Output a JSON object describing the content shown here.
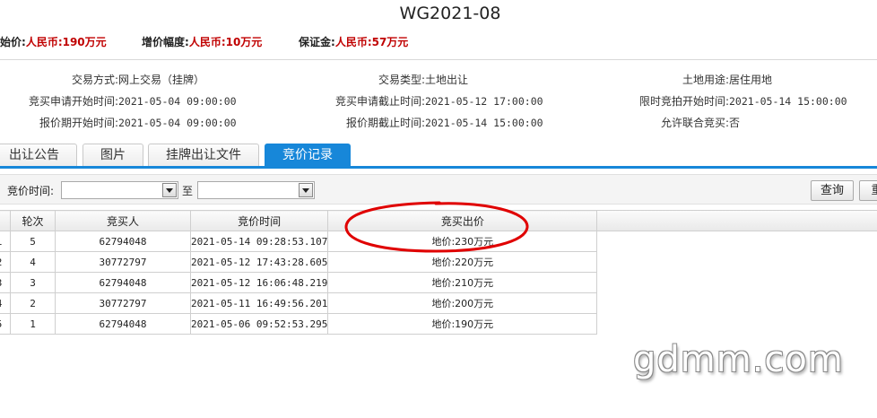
{
  "title": "WG2021-08",
  "price_bar": {
    "start_label": "起始价:",
    "start_value": "人民币:190万元",
    "increment_label": "增价幅度:",
    "increment_value": "人民币:10万元",
    "deposit_label": "保证金:",
    "deposit_value": "人民币:57万元"
  },
  "info": {
    "trade_mode_label": "交易方式:",
    "trade_mode_value": "网上交易（挂牌）",
    "trade_type_label": "交易类型:",
    "trade_type_value": "土地出让",
    "land_use_label": "土地用途:",
    "land_use_value": "居住用地",
    "apply_start_label": "竞买申请开始时间:",
    "apply_start_value": "2021-05-04 09:00:00",
    "apply_end_label": "竞买申请截止时间:",
    "apply_end_value": "2021-05-12 17:00:00",
    "timed_start_label": "限时竞拍开始时间:",
    "timed_start_value": "2021-05-14 15:00:00",
    "quote_start_label": "报价期开始时间:",
    "quote_start_value": "2021-05-04 09:00:00",
    "quote_end_label": "报价期截止时间:",
    "quote_end_value": "2021-05-14 15:00:00",
    "joint_label": "允许联合竞买:",
    "joint_value": "否"
  },
  "tabs": [
    {
      "label": "出让公告"
    },
    {
      "label": "图片"
    },
    {
      "label": "挂牌出让文件"
    },
    {
      "label": "竞价记录"
    }
  ],
  "filter": {
    "time_label": "竞价时间:",
    "to_label": "至",
    "from_value": "",
    "to_value": "",
    "query_label": "查询",
    "reset_label": "重"
  },
  "table": {
    "headers": [
      "",
      "轮次",
      "竞买人",
      "竞价时间",
      "竞买出价"
    ],
    "rows": [
      {
        "idx": "1",
        "round": "5",
        "bidder": "62794048",
        "time": "2021-05-14 09:28:53.107",
        "price": "地价:230万元"
      },
      {
        "idx": "2",
        "round": "4",
        "bidder": "30772797",
        "time": "2021-05-12 17:43:28.605",
        "price": "地价:220万元"
      },
      {
        "idx": "3",
        "round": "3",
        "bidder": "62794048",
        "time": "2021-05-12 16:06:48.219",
        "price": "地价:210万元"
      },
      {
        "idx": "4",
        "round": "2",
        "bidder": "30772797",
        "time": "2021-05-11 16:49:56.201",
        "price": "地价:200万元"
      },
      {
        "idx": "5",
        "round": "1",
        "bidder": "62794048",
        "time": "2021-05-06 09:52:53.295",
        "price": "地价:190万元"
      }
    ]
  },
  "annotation_color": "#e00000",
  "tab_active_color": "#1787d9",
  "watermark": "gdmm.com"
}
